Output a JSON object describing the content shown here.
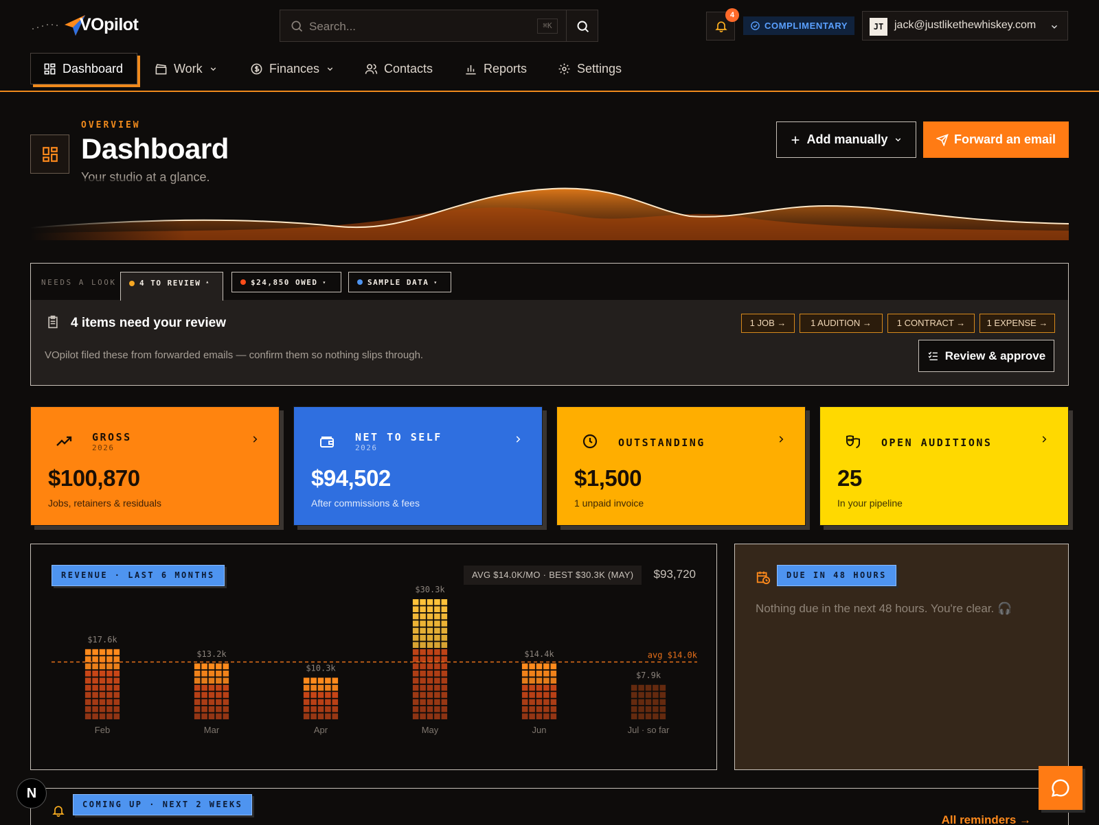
{
  "app": {
    "name": "VOpilot"
  },
  "search": {
    "placeholder": "Search...",
    "shortcut": "⌘K"
  },
  "notifications": {
    "count": "4"
  },
  "plan": {
    "label": "COMPLIMENTARY"
  },
  "user": {
    "initials": "JT",
    "email": "jack@justlikethewhiskey.com"
  },
  "nav": [
    {
      "label": "Dashboard",
      "icon": "dashboard-icon",
      "active": true
    },
    {
      "label": "Work",
      "icon": "clapperboard-icon",
      "dropdown": true
    },
    {
      "label": "Finances",
      "icon": "dollar-circle-icon",
      "dropdown": true
    },
    {
      "label": "Contacts",
      "icon": "users-icon"
    },
    {
      "label": "Reports",
      "icon": "bar-chart-icon"
    },
    {
      "label": "Settings",
      "icon": "gear-icon"
    }
  ],
  "header": {
    "overline": "OVERVIEW",
    "title": "Dashboard",
    "subtitle": "Your studio at a glance.",
    "add_label": "Add manually",
    "forward_label": "Forward an email"
  },
  "look": {
    "label": "NEEDS A LOOK",
    "tabs": [
      {
        "label": "4 TO REVIEW",
        "caret": "▴",
        "dot": "#f5a623"
      },
      {
        "label": "$24,850 OWED",
        "caret": "▾",
        "dot": "#ff4d1a"
      },
      {
        "label": "SAMPLE DATA",
        "caret": "▾",
        "dot": "#4e94f0"
      }
    ],
    "title": "4 items need your review",
    "description": "VOpilot filed these from forwarded emails — confirm them so nothing slips through.",
    "chips": [
      "1 JOB →",
      "1 AUDITION →",
      "1 CONTRACT →",
      "1 EXPENSE →"
    ],
    "review_label": "Review & approve"
  },
  "cards": [
    {
      "label": "GROSS",
      "year": "2026",
      "value": "$100,870",
      "sub": "Jobs, retainers & residuals",
      "bg": "#ff840f",
      "fg": "#1a0f05",
      "icon": "trending-up-icon"
    },
    {
      "label": "NET TO SELF",
      "year": "2026",
      "value": "$94,502",
      "sub": "After commissions & fees",
      "bg": "#2f6fe0",
      "fg": "#ffffff",
      "icon": "wallet-icon"
    },
    {
      "label": "OUTSTANDING",
      "year": "",
      "value": "$1,500",
      "sub": "1 unpaid invoice",
      "bg": "#ffae00",
      "fg": "#1a0f05",
      "icon": "clock-icon"
    },
    {
      "label": "OPEN AUDITIONS",
      "year": "",
      "value": "25",
      "sub": "In your pipeline",
      "bg": "#ffd900",
      "fg": "#1a1405",
      "icon": "theater-masks-icon"
    }
  ],
  "revenue": {
    "tag": "REVENUE · LAST 6 MONTHS",
    "stats": "AVG $14.0K/MO · BEST $30.3K (MAY)",
    "total": "$93,720",
    "avg_label": "avg $14.0k"
  },
  "chart_data": {
    "type": "bar",
    "title": "REVENUE · LAST 6 MONTHS",
    "categories": [
      "Feb",
      "Mar",
      "Apr",
      "May",
      "Jun",
      "Jul · so far"
    ],
    "values": [
      17.6,
      13.2,
      10.3,
      30.3,
      14.4,
      7.9
    ],
    "value_labels": [
      "$17.6k",
      "$13.2k",
      "$10.3k",
      "$30.3k",
      "$14.4k",
      "$7.9k"
    ],
    "unit": "$k",
    "average": 14.0,
    "average_label": "avg $14.0k",
    "ylim": [
      0,
      31
    ],
    "grid": false,
    "legend": "none",
    "colors": {
      "high": "#ffc23a",
      "mid": "#ff8a1c",
      "low": "#e8501a",
      "partial": "#6e2e10",
      "avg_line": "#e8701a"
    }
  },
  "due": {
    "tag": "DUE IN 48 HOURS",
    "message": "Nothing due in the next 48 hours. You're clear. 🎧"
  },
  "coming": {
    "tag": "COMING UP · NEXT 2 WEEKS",
    "link": "All reminders →"
  },
  "fab": {
    "n_label": "N"
  }
}
